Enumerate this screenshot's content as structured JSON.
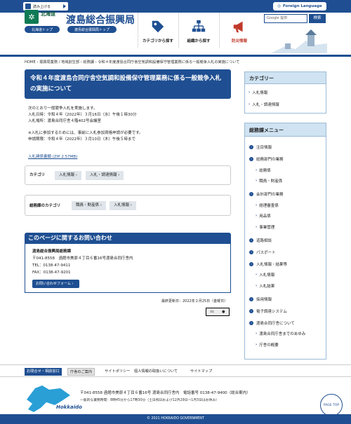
{
  "topbar": {
    "read_aloud": "読み上げる",
    "language": "Foreign Language"
  },
  "header": {
    "pref_label": "北海道",
    "pref_top": "北海道トップ",
    "office_ruby": "おしま そうごうしんこうきょく",
    "office_name": "渡島総合振興局",
    "office_top": "渡島総合振興局トップ",
    "nav": [
      {
        "label": "カテゴリから探す",
        "icon": "tag-icon"
      },
      {
        "label": "組織から探す",
        "icon": "org-chart-icon"
      },
      {
        "label": "防災情報",
        "icon": "megaphone-icon"
      }
    ],
    "search_placeholder": "Google 提供",
    "search_button": "検索"
  },
  "breadcrumb": "HOME  ›  振興局業務 / 地域創生部  ›  総務課  ›  令和４年度渡島合同庁舎空気調和設備保守管理業務に係る一般競争入札の実施について",
  "main": {
    "title": "令和４年度渡島合同庁舎空気調和設備保守管理業務に係る一般競争入札の実施について",
    "body_lines": [
      "次のとおり一般競争入札を実施します。",
      "入札日時：令和４年（2022年）３月16日（水）午後１時30分",
      "入札場所：渡島合同庁舎４階402号会議室",
      "",
      "※入札に参加するためには、事前に入札参加資格申請が必要です。",
      "申請期限：令和４年（2022年）３月10日（木）午後５時まで"
    ],
    "doc_link": "入札関係書類 (ZIP 2.57MB)",
    "category_label": "カテゴリ",
    "category_tags": [
      "入札情報",
      "入札・調達情報"
    ],
    "dept_category_label": "総務課のカテゴリ",
    "dept_category_tags": [
      "職員・財産係",
      "入札情報"
    ],
    "contact_heading": "このページに関するお問い合わせ",
    "contact_lines": [
      "渡島総合振興局総務課",
      "〒041-8558　函館市美原４丁目６番16号渡島合同庁舎内",
      "TEL：0138-47-9411",
      "FAX：0138-47-9201"
    ],
    "contact_button": "お問い合わせフォーム",
    "updated": "最終更新日：2022年２月25日（金曜日）",
    "cc_label": "cc"
  },
  "sidebar": {
    "category_heading": "カテゴリー",
    "category_items": [
      "入札情報",
      "入札・調達情報"
    ],
    "menu_heading": "総務課メニュー",
    "menu_items": [
      {
        "label": "注目情報",
        "level": 1
      },
      {
        "label": "総務部門の業務",
        "level": 1
      },
      {
        "label": "総務係",
        "level": 2
      },
      {
        "label": "職員・財産係",
        "level": 2
      },
      {
        "label": "会計部門の業務",
        "level": 1
      },
      {
        "label": "経理審査係",
        "level": 2
      },
      {
        "label": "用品係",
        "level": 2
      },
      {
        "label": "事業管理",
        "level": 2
      },
      {
        "label": "道路相談",
        "level": 1
      },
      {
        "label": "パスポート",
        "level": 1
      },
      {
        "label": "入札情報・結果等",
        "level": 1
      },
      {
        "label": "入札情報",
        "level": 2
      },
      {
        "label": "入札結果",
        "level": 2
      },
      {
        "label": "採用情報",
        "level": 1
      },
      {
        "label": "電子調達システム",
        "level": 1
      },
      {
        "label": "渡島合同庁舎について",
        "level": 1
      },
      {
        "label": "渡島合同庁舎までのあゆみ",
        "level": 2
      },
      {
        "label": "庁舎の概要",
        "level": 2
      }
    ]
  },
  "footer": {
    "links": [
      "お問合せ・相談窓口",
      "庁舎のご案内",
      "サイトポリシー",
      "個人情報の取扱いについて",
      "サイトマップ"
    ],
    "address": "〒041-8558 函館市美原４丁目６番16号 渡島合同庁舎内　電話番号 0138-47-9400（総合案内）",
    "hours": "一般的な業務時間：8時45分から17時30分（土日祝日および12月29日～1月3日はお休み）",
    "logo_text": "Hokkaido",
    "page_top": "PAGE TOP",
    "copyright": "© 2021 HOKKAIDO GOVERNMENT"
  }
}
